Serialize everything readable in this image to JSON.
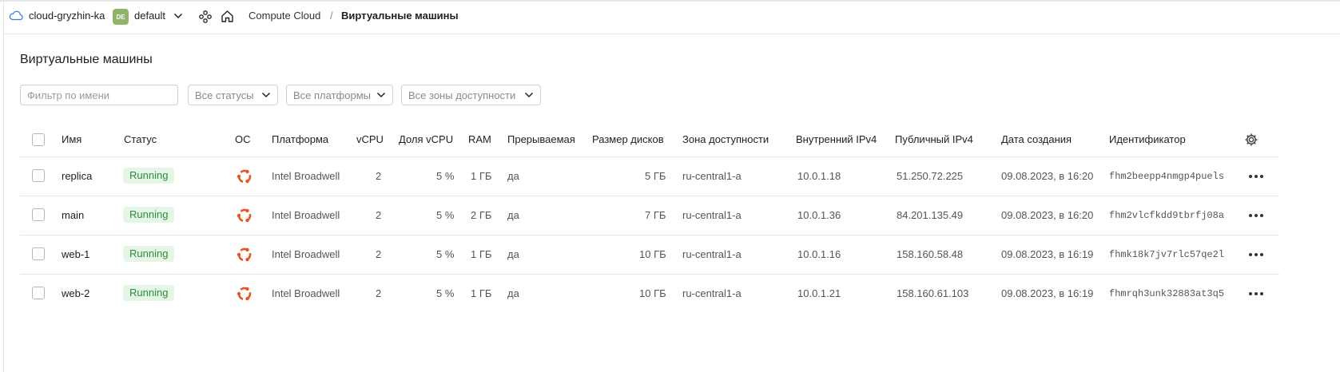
{
  "header": {
    "cloud_name": "cloud-gryzhin-ka",
    "folder_badge": "DE",
    "folder_name": "default",
    "breadcrumb": {
      "service": "Compute Cloud",
      "separator": "/",
      "current": "Виртуальные машины"
    },
    "icons": [
      "cloud-icon",
      "chevron-down-icon",
      "services-icon",
      "home-icon"
    ]
  },
  "page": {
    "title": "Виртуальные машины"
  },
  "filters": {
    "name_placeholder": "Фильтр по имени",
    "name_value": "",
    "status": "Все статусы",
    "platform": "Все платформы",
    "zone": "Все зоны доступности"
  },
  "table": {
    "columns": {
      "name": "Имя",
      "status": "Статус",
      "os": "ОС",
      "platform": "Платформа",
      "vcpu": "vCPU",
      "vcpu_share": "Доля vCPU",
      "ram": "RAM",
      "preemptible": "Прерываемая",
      "disk_size": "Размер дисков",
      "zone": "Зона доступности",
      "internal_ipv4": "Внутренний IPv4",
      "public_ipv4": "Публичный IPv4",
      "created": "Дата создания",
      "id": "Идентификатор"
    },
    "rows": [
      {
        "name": "replica",
        "status": "Running",
        "os_icon": "ubuntu-icon",
        "platform": "Intel Broadwell",
        "vcpu": "2",
        "vcpu_share": "5 %",
        "ram": "1 ГБ",
        "preemptible": "да",
        "disk_size": "5 ГБ",
        "zone": "ru-central1-a",
        "internal_ipv4": "10.0.1.18",
        "public_ipv4": "51.250.72.225",
        "created": "09.08.2023, в 16:20",
        "id": "fhm2beepp4nmgp4puels"
      },
      {
        "name": "main",
        "status": "Running",
        "os_icon": "ubuntu-icon",
        "platform": "Intel Broadwell",
        "vcpu": "2",
        "vcpu_share": "5 %",
        "ram": "2 ГБ",
        "preemptible": "да",
        "disk_size": "7 ГБ",
        "zone": "ru-central1-a",
        "internal_ipv4": "10.0.1.36",
        "public_ipv4": "84.201.135.49",
        "created": "09.08.2023, в 16:20",
        "id": "fhm2vlcfkdd9tbrfj08a"
      },
      {
        "name": "web-1",
        "status": "Running",
        "os_icon": "ubuntu-icon",
        "platform": "Intel Broadwell",
        "vcpu": "2",
        "vcpu_share": "5 %",
        "ram": "1 ГБ",
        "preemptible": "да",
        "disk_size": "10 ГБ",
        "zone": "ru-central1-a",
        "internal_ipv4": "10.0.1.16",
        "public_ipv4": "158.160.58.48",
        "created": "09.08.2023, в 16:19",
        "id": "fhmk18k7jv7rlc57qe2l"
      },
      {
        "name": "web-2",
        "status": "Running",
        "os_icon": "ubuntu-icon",
        "platform": "Intel Broadwell",
        "vcpu": "2",
        "vcpu_share": "5 %",
        "ram": "1 ГБ",
        "preemptible": "да",
        "disk_size": "10 ГБ",
        "zone": "ru-central1-a",
        "internal_ipv4": "10.0.1.21",
        "public_ipv4": "158.160.61.103",
        "created": "09.08.2023, в 16:19",
        "id": "fhmrqh3unk32883at3q5"
      }
    ]
  },
  "colors": {
    "status_running_bg": "#e5f6e6",
    "status_running_text": "#2e8b3a",
    "ubuntu_orange": "#e95420",
    "folder_badge": "#8fb36b",
    "cloud_icon": "#3b7ddd"
  }
}
